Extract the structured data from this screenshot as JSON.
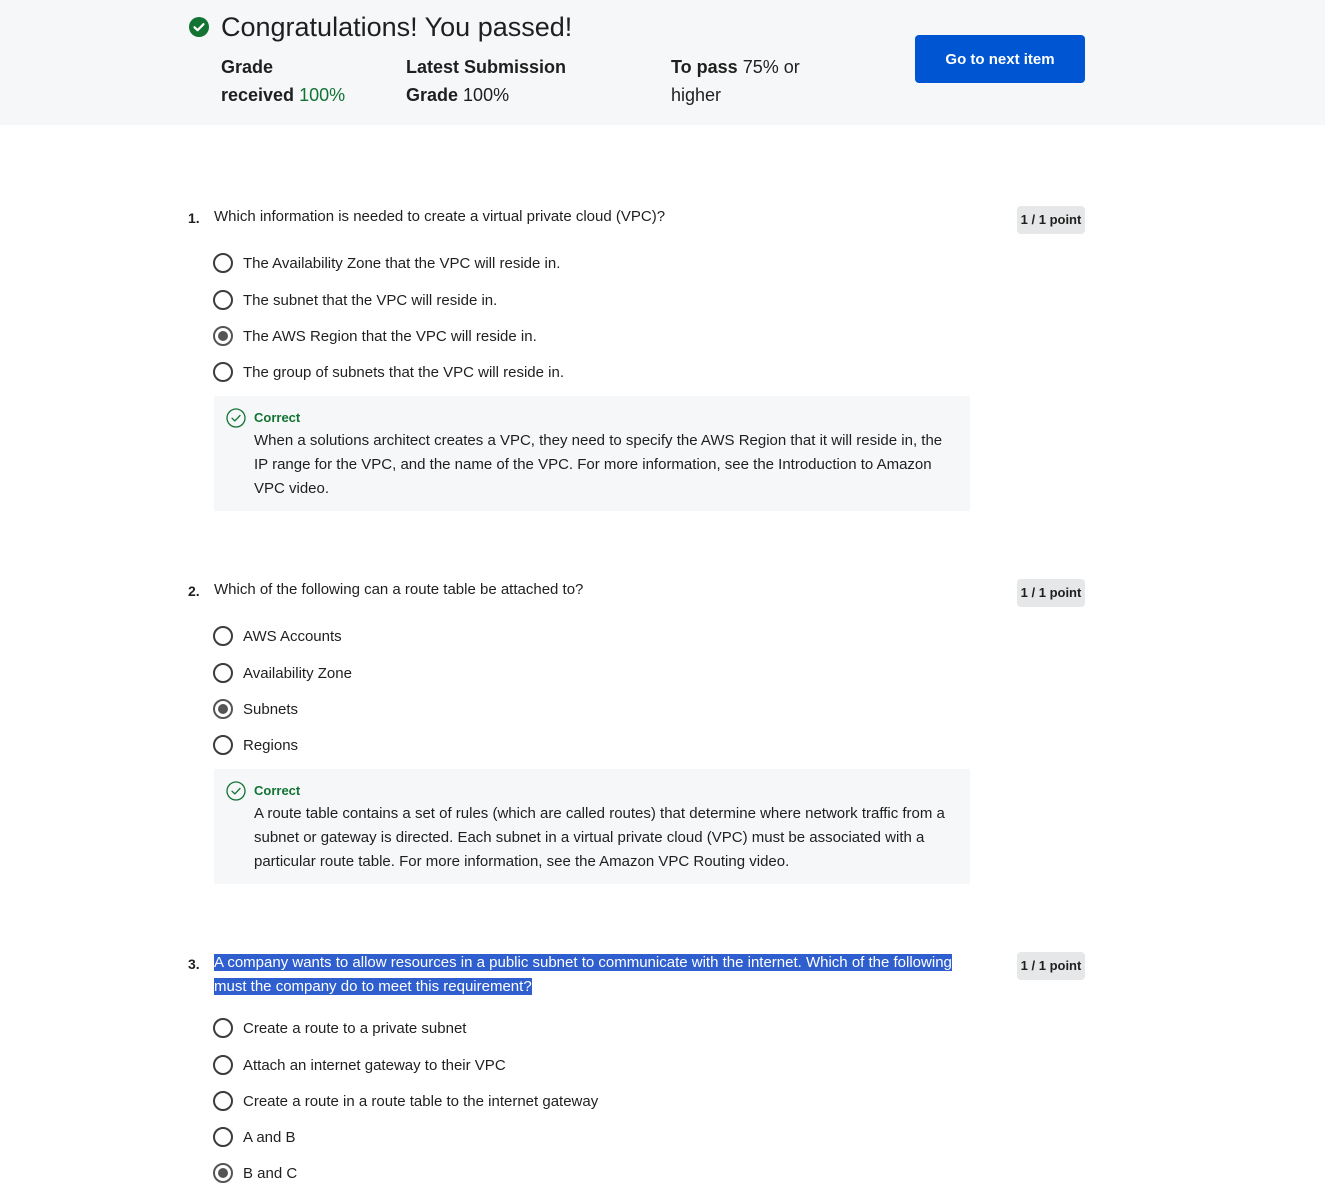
{
  "banner": {
    "title": "Congratulations! You passed!",
    "grade_received_label_1": "Grade",
    "grade_received_label_2": "received",
    "grade_received_value": "100%",
    "latest_label_1": "Latest Submission",
    "latest_label_2": "Grade",
    "latest_value": "100%",
    "to_pass_label": "To pass",
    "to_pass_value_1": "75% or",
    "to_pass_value_2": "higher",
    "next_button": "Go to next item",
    "icon": "check-circle-filled-icon",
    "accent_color": "#137333",
    "button_color": "#0056d2"
  },
  "questions": [
    {
      "number": "1.",
      "text": "Which information is needed to create a virtual private cloud (VPC)?",
      "points": "1 / 1 point",
      "options": [
        {
          "label": "The Availability Zone that the VPC will reside in.",
          "selected": false
        },
        {
          "label": "The subnet that the VPC will reside in.",
          "selected": false
        },
        {
          "label": "The AWS Region that the VPC will reside in.",
          "selected": true
        },
        {
          "label": "The group of subnets that the VPC will reside in.",
          "selected": false
        }
      ],
      "feedback": {
        "title": "Correct",
        "text": "When a solutions architect creates a VPC, they need to specify the AWS Region that it will reside in, the IP range for the VPC, and the name of the VPC. For more information, see the Introduction to Amazon VPC video."
      }
    },
    {
      "number": "2.",
      "text": "Which of the following can a route table be attached to?",
      "points": "1 / 1 point",
      "options": [
        {
          "label": "AWS Accounts",
          "selected": false
        },
        {
          "label": "Availability Zone",
          "selected": false
        },
        {
          "label": "Subnets",
          "selected": true
        },
        {
          "label": "Regions",
          "selected": false
        }
      ],
      "feedback": {
        "title": "Correct",
        "text": "A route table contains a set of rules (which are called routes) that determine where network traffic from a subnet or gateway is directed. Each subnet in a virtual private cloud (VPC) must be associated with a particular route table. For more information, see the Amazon VPC Routing video."
      }
    },
    {
      "number": "3.",
      "text": "A company wants to allow resources in a public subnet to communicate with the internet. Which of the following must the company do to meet this requirement?",
      "points": "1 / 1 point",
      "options": [
        {
          "label": "Create a route to a private subnet",
          "selected": false
        },
        {
          "label": "Attach an internet gateway to their VPC",
          "selected": false
        },
        {
          "label": "Create a route in a route table to the internet gateway",
          "selected": false
        },
        {
          "label": "A and B",
          "selected": false
        },
        {
          "label": "B and C",
          "selected": true
        }
      ]
    }
  ]
}
